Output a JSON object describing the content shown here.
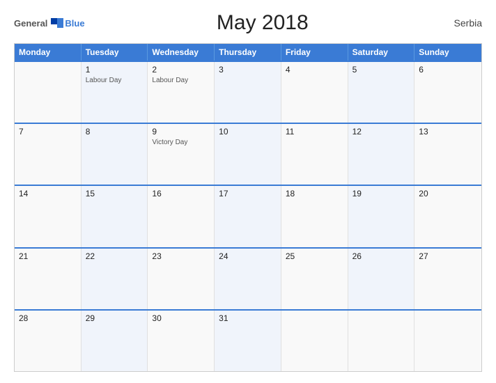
{
  "header": {
    "logo_general": "General",
    "logo_blue": "Blue",
    "title": "May 2018",
    "country": "Serbia"
  },
  "calendar": {
    "days_of_week": [
      "Monday",
      "Tuesday",
      "Wednesday",
      "Thursday",
      "Friday",
      "Saturday",
      "Sunday"
    ],
    "weeks": [
      [
        {
          "day": "",
          "holiday": ""
        },
        {
          "day": "1",
          "holiday": "Labour Day"
        },
        {
          "day": "2",
          "holiday": "Labour Day"
        },
        {
          "day": "3",
          "holiday": ""
        },
        {
          "day": "4",
          "holiday": ""
        },
        {
          "day": "5",
          "holiday": ""
        },
        {
          "day": "6",
          "holiday": ""
        }
      ],
      [
        {
          "day": "7",
          "holiday": ""
        },
        {
          "day": "8",
          "holiday": ""
        },
        {
          "day": "9",
          "holiday": "Victory Day"
        },
        {
          "day": "10",
          "holiday": ""
        },
        {
          "day": "11",
          "holiday": ""
        },
        {
          "day": "12",
          "holiday": ""
        },
        {
          "day": "13",
          "holiday": ""
        }
      ],
      [
        {
          "day": "14",
          "holiday": ""
        },
        {
          "day": "15",
          "holiday": ""
        },
        {
          "day": "16",
          "holiday": ""
        },
        {
          "day": "17",
          "holiday": ""
        },
        {
          "day": "18",
          "holiday": ""
        },
        {
          "day": "19",
          "holiday": ""
        },
        {
          "day": "20",
          "holiday": ""
        }
      ],
      [
        {
          "day": "21",
          "holiday": ""
        },
        {
          "day": "22",
          "holiday": ""
        },
        {
          "day": "23",
          "holiday": ""
        },
        {
          "day": "24",
          "holiday": ""
        },
        {
          "day": "25",
          "holiday": ""
        },
        {
          "day": "26",
          "holiday": ""
        },
        {
          "day": "27",
          "holiday": ""
        }
      ],
      [
        {
          "day": "28",
          "holiday": ""
        },
        {
          "day": "29",
          "holiday": ""
        },
        {
          "day": "30",
          "holiday": ""
        },
        {
          "day": "31",
          "holiday": ""
        },
        {
          "day": "",
          "holiday": ""
        },
        {
          "day": "",
          "holiday": ""
        },
        {
          "day": "",
          "holiday": ""
        }
      ]
    ]
  }
}
